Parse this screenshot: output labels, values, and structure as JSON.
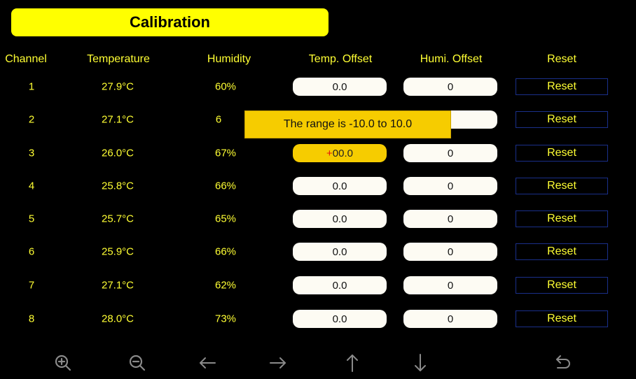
{
  "title": "Calibration",
  "headers": {
    "channel": "Channel",
    "temperature": "Temperature",
    "humidity": "Humidity",
    "temp_offset": "Temp. Offset",
    "humi_offset": "Humi. Offset",
    "reset": "Reset"
  },
  "rows": [
    {
      "channel": "1",
      "temperature": "27.9°C",
      "humidity": "60%",
      "temp_offset": "0.0",
      "humi_offset": "0",
      "reset": "Reset"
    },
    {
      "channel": "2",
      "temperature": "27.1°C",
      "humidity": "6",
      "temp_offset": "",
      "humi_offset": "",
      "reset": "Reset"
    },
    {
      "channel": "3",
      "temperature": "26.0°C",
      "humidity": "67%",
      "temp_offset_sign": "+",
      "temp_offset": "00.0",
      "humi_offset": "0",
      "reset": "Reset"
    },
    {
      "channel": "4",
      "temperature": "25.8°C",
      "humidity": "66%",
      "temp_offset": "0.0",
      "humi_offset": "0",
      "reset": "Reset"
    },
    {
      "channel": "5",
      "temperature": "25.7°C",
      "humidity": "65%",
      "temp_offset": "0.0",
      "humi_offset": "0",
      "reset": "Reset"
    },
    {
      "channel": "6",
      "temperature": "25.9°C",
      "humidity": "66%",
      "temp_offset": "0.0",
      "humi_offset": "0",
      "reset": "Reset"
    },
    {
      "channel": "7",
      "temperature": "27.1°C",
      "humidity": "62%",
      "temp_offset": "0.0",
      "humi_offset": "0",
      "reset": "Reset"
    },
    {
      "channel": "8",
      "temperature": "28.0°C",
      "humidity": "73%",
      "temp_offset": "0.0",
      "humi_offset": "0",
      "reset": "Reset"
    }
  ],
  "tooltip": "The range is -10.0 to 10.0",
  "toolbar": [
    "zoom-in-icon",
    "zoom-out-icon",
    "arrow-left-icon",
    "arrow-right-icon",
    "arrow-up-icon",
    "arrow-down-icon",
    "undo-icon"
  ],
  "colors": {
    "accent": "#ffff00",
    "text": "#ffff33",
    "active_field": "#f6cc00",
    "reset_border": "#1a2f8a",
    "background": "#000000"
  }
}
